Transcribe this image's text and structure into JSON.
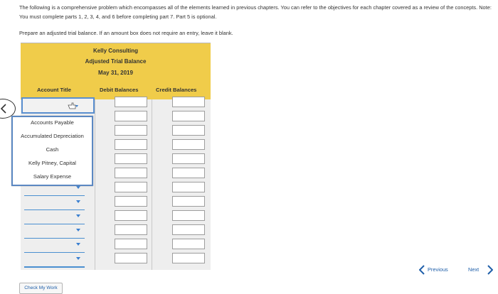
{
  "instructions": "The following is a comprehensive problem which encompasses all of the elements learned in previous chapters. You can refer to the objectives for each chapter covered as a review of the concepts. Note: You must complete parts 1, 2, 3, 4, and 6 before completing part 7. Part 5 is optional.",
  "prompt": "Prepare an adjusted trial balance. If an amount box does not require an entry, leave it blank.",
  "trial_balance": {
    "company": "Kelly Consulting",
    "title": "Adjusted Trial Balance",
    "date": "May 31, 2019",
    "columns": {
      "account_title": "Account Title",
      "debit": "Debit Balances",
      "credit": "Credit Balances"
    }
  },
  "dropdown": {
    "options": [
      "Accounts Payable",
      "Accumulated Depreciation",
      "Cash",
      "Kelly Pitney, Capital",
      "Salary Expense"
    ]
  },
  "buttons": {
    "check_my_work": "Check My Work",
    "previous": "Previous",
    "next": "Next"
  },
  "icons": {
    "back": "chevron-left-icon",
    "caret": "caret-down-icon",
    "cursor": "hand-pointer-icon"
  },
  "colors": {
    "header_bg": "#f0cc4a",
    "accent": "#1f5fa9",
    "select_border": "#5a8fcf"
  }
}
